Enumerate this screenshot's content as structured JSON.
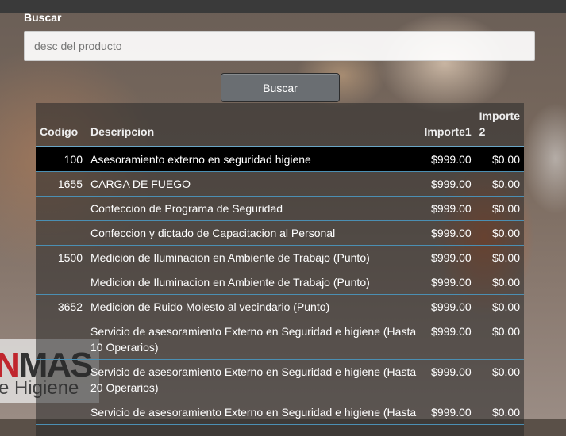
{
  "search": {
    "label": "Buscar",
    "placeholder": "desc del producto",
    "value": "",
    "button_label": "Buscar"
  },
  "table": {
    "headers": {
      "codigo": "Codigo",
      "descripcion": "Descripcion",
      "importe1": "Importe1",
      "importe2": "Importe 2"
    },
    "rows": [
      {
        "codigo": "100",
        "descripcion": "Asesoramiento externo en seguridad higiene",
        "importe1": "$999.00",
        "importe2": "$0.00"
      },
      {
        "codigo": "1655",
        "descripcion": "CARGA DE FUEGO",
        "importe1": "$999.00",
        "importe2": "$0.00"
      },
      {
        "codigo": "",
        "descripcion": "Confeccion de Programa de Seguridad",
        "importe1": "$999.00",
        "importe2": "$0.00"
      },
      {
        "codigo": "",
        "descripcion": "Confeccion y dictado de Capacitacion al Personal",
        "importe1": "$999.00",
        "importe2": "$0.00"
      },
      {
        "codigo": "1500",
        "descripcion": "Medicion de Iluminacion en Ambiente de Trabajo (Punto)",
        "importe1": "$999.00",
        "importe2": "$0.00"
      },
      {
        "codigo": "",
        "descripcion": "Medicion de Iluminacion en Ambiente de Trabajo (Punto)",
        "importe1": "$999.00",
        "importe2": "$0.00"
      },
      {
        "codigo": "3652",
        "descripcion": "Medicion de Ruido Molesto al vecindario (Punto)",
        "importe1": "$999.00",
        "importe2": "$0.00"
      },
      {
        "codigo": "",
        "descripcion": "Servicio de asesoramiento Externo en Seguridad e higiene (Hasta 10 Operarios)",
        "importe1": "$999.00",
        "importe2": "$0.00"
      },
      {
        "codigo": "",
        "descripcion": "Servicio de asesoramiento Externo en Seguridad e higiene (Hasta 20 Operarios)",
        "importe1": "$999.00",
        "importe2": "$0.00"
      },
      {
        "codigo": "",
        "descripcion": "Servicio de asesoramiento Externo en Seguridad e higiene (Hasta",
        "importe1": "$999.00",
        "importe2": "$0.00"
      }
    ]
  },
  "background": {
    "logo_text_red": "N",
    "logo_text": "MAS",
    "logo_sub": "e Higiene"
  }
}
